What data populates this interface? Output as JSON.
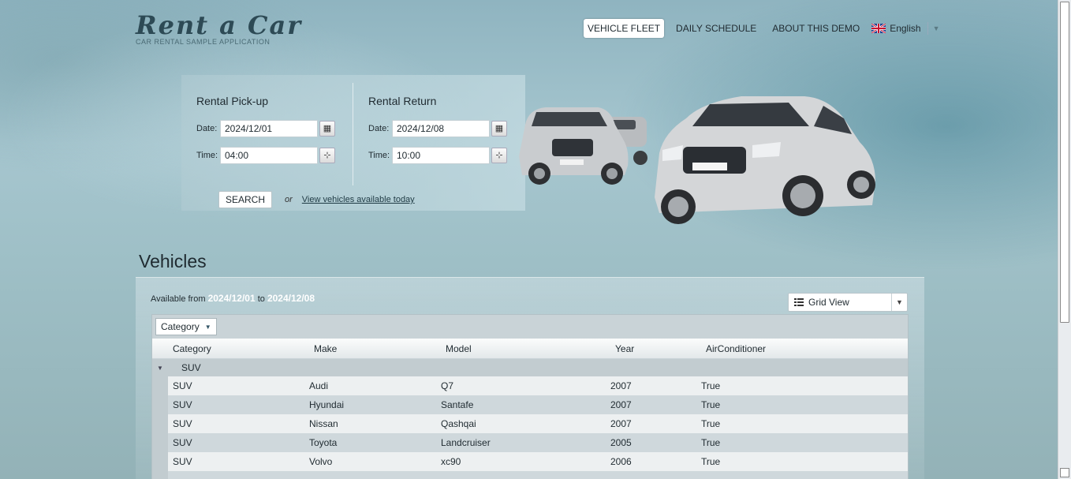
{
  "header": {
    "logo_title": "Rent a Car",
    "logo_subtitle": "CAR RENTAL SAMPLE APPLICATION",
    "nav": [
      {
        "label": "VEHICLE FLEET",
        "active": true
      },
      {
        "label": "DAILY SCHEDULE",
        "active": false
      },
      {
        "label": "ABOUT THIS DEMO",
        "active": false
      }
    ],
    "language": "English"
  },
  "search": {
    "pickup": {
      "title": "Rental Pick-up",
      "date_label": "Date:",
      "date_value": "2024/12/01",
      "time_label": "Time:",
      "time_value": "04:00"
    },
    "return": {
      "title": "Rental Return",
      "date_label": "Date:",
      "date_value": "2024/12/08",
      "time_label": "Time:",
      "time_value": "10:00"
    },
    "search_button": "SEARCH",
    "or_text": "or",
    "today_link": "View vehicles available today"
  },
  "vehicles": {
    "title": "Vehicles",
    "available_prefix": "Available from",
    "available_from": "2024/12/01",
    "available_to_word": "to",
    "available_to": "2024/12/08",
    "view_select": "Grid View",
    "group_chip": "Category",
    "columns": [
      "Category",
      "Make",
      "Model",
      "Year",
      "AirConditioner"
    ],
    "group_label": "SUV",
    "rows": [
      [
        "SUV",
        "Audi",
        "Q7",
        "2007",
        "True"
      ],
      [
        "SUV",
        "Hyundai",
        "Santafe",
        "2007",
        "True"
      ],
      [
        "SUV",
        "Nissan",
        "Qashqai",
        "2007",
        "True"
      ],
      [
        "SUV",
        "Toyota",
        "Landcruiser",
        "2005",
        "True"
      ],
      [
        "SUV",
        "Volvo",
        "xc90",
        "2006",
        "True"
      ]
    ]
  },
  "colors": {
    "accent_dark": "#2d4a55",
    "grid_group_bg": "#c2ccd0",
    "row_alt_bg": "#cfd8dc"
  }
}
